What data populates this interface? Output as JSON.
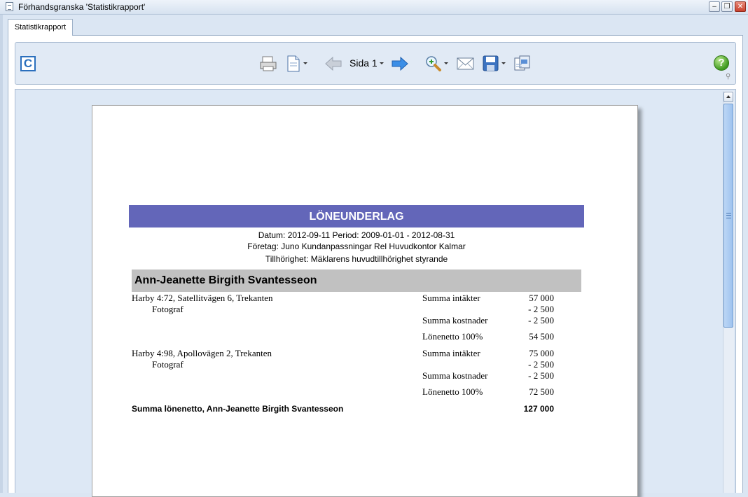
{
  "window": {
    "title": "Förhandsgranska 'Statistikrapport'"
  },
  "tabs": [
    {
      "label": "Statistikrapport",
      "active": true
    }
  ],
  "toolbar": {
    "logo_letter": "C",
    "page_label": "Sida 1",
    "help_glyph": "?"
  },
  "report": {
    "title": "LÖNEUNDERLAG",
    "date_period_line": "Datum: 2012-09-11 Period: 2009-01-01 - 2012-08-31",
    "company_line": "Företag: Juno Kundanpassningar Rel Huvudkontor Kalmar",
    "affiliation_line": "Tillhörighet: Mäklarens huvudtillhörighet styrande",
    "person_name": "Ann-Jeanette Birgith Svantesseon",
    "properties": [
      {
        "address": "Harby 4:72, Satellitvägen 6, Trekanten",
        "role": "Fotograf",
        "income_label": "Summa intäkter",
        "income": "57 000",
        "deduction": "-  2 500",
        "cost_label": "Summa kostnader",
        "cost": "-  2 500",
        "net_label": "Lönenetto 100%",
        "net": "54 500"
      },
      {
        "address": "Harby 4:98, Apollovägen 2, Trekanten",
        "role": "Fotograf",
        "income_label": "Summa intäkter",
        "income": "75 000",
        "deduction": "-  2 500",
        "cost_label": "Summa kostnader",
        "cost": "-  2 500",
        "net_label": "Lönenetto 100%",
        "net": "72 500"
      }
    ],
    "total_label": "Summa lönenetto, Ann-Jeanette Birgith Svantesseon",
    "total_amount": "127 000"
  },
  "colors": {
    "header_bar": "#6366b9",
    "name_bar": "#c1c1c1",
    "accent": "#2a6fbd"
  }
}
